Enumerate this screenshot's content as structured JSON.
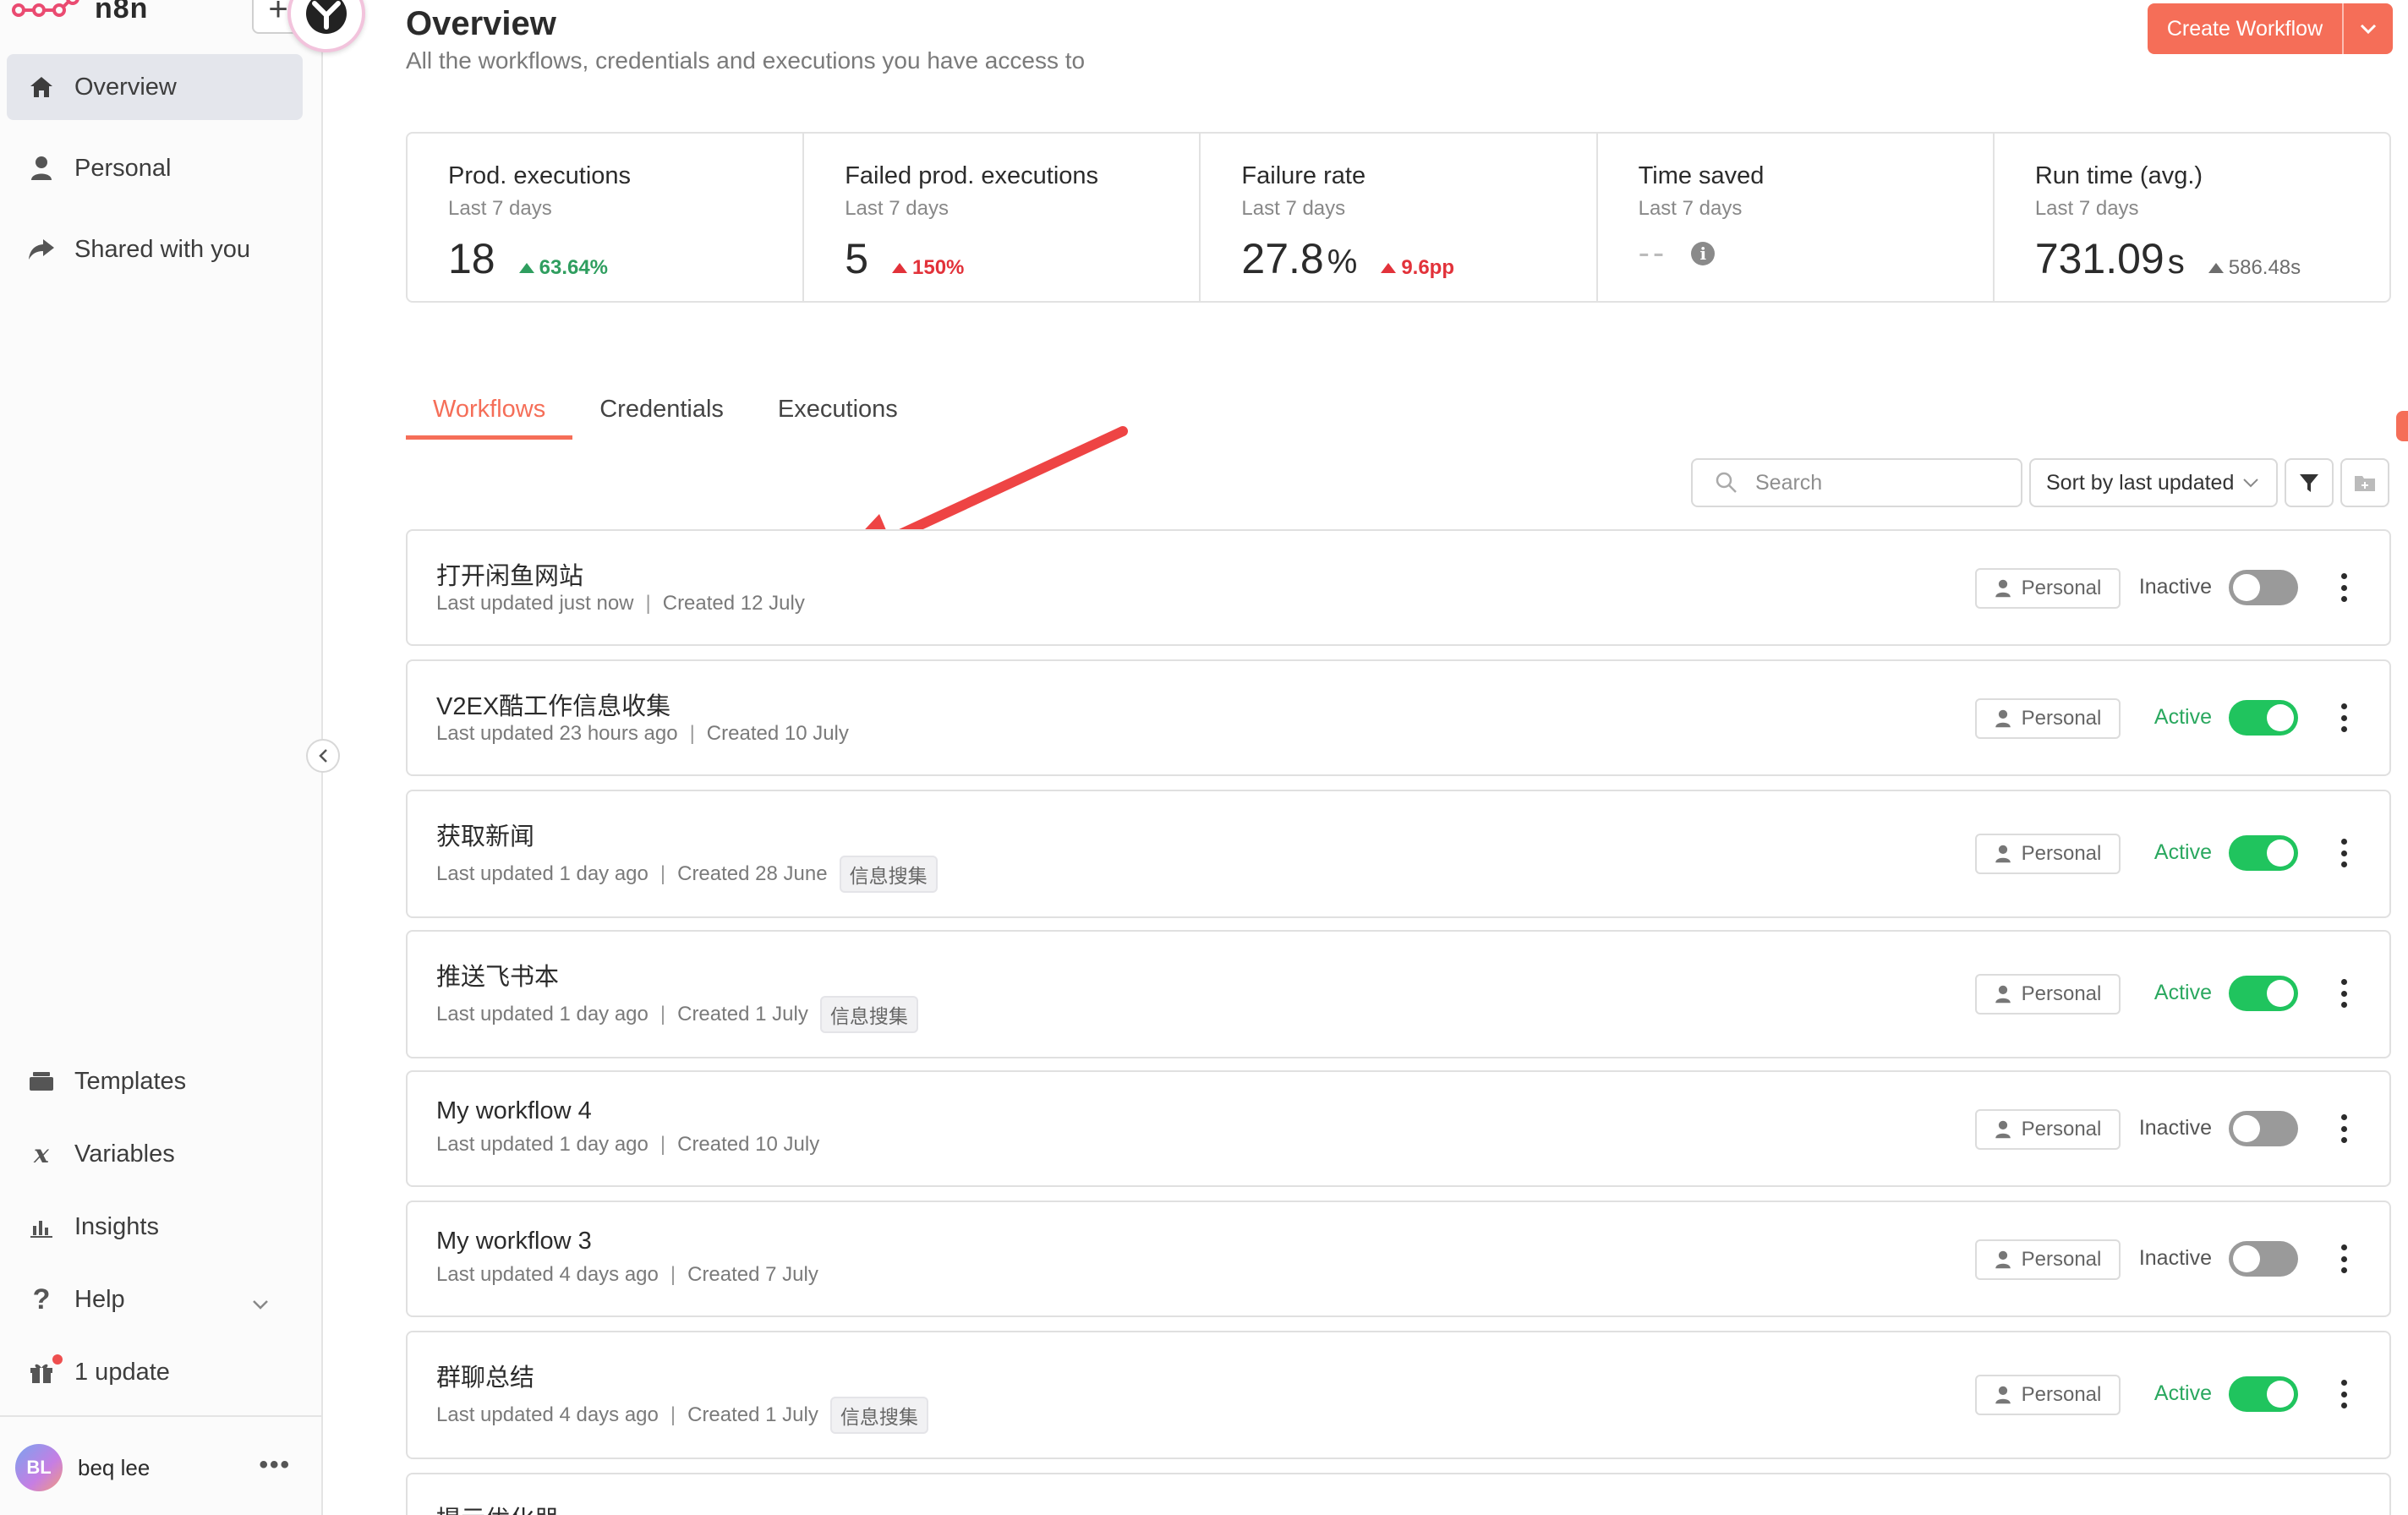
{
  "app": {
    "name": "n8n"
  },
  "sidebar": {
    "items": [
      {
        "label": "Overview",
        "icon": "home-icon"
      },
      {
        "label": "Personal",
        "icon": "user-icon"
      },
      {
        "label": "Shared with you",
        "icon": "share-icon"
      }
    ],
    "bottom_items": [
      {
        "label": "Templates",
        "icon": "templates-icon"
      },
      {
        "label": "Variables",
        "icon": "variables-icon"
      },
      {
        "label": "Insights",
        "icon": "insights-icon"
      },
      {
        "label": "Help",
        "icon": "help-icon"
      },
      {
        "label": "1 update",
        "icon": "gift-icon"
      }
    ],
    "user": {
      "initials": "BL",
      "name": "beq lee"
    }
  },
  "header": {
    "title": "Overview",
    "subtitle": "All the workflows, credentials and executions you have access to",
    "create_label": "Create Workflow"
  },
  "stats": [
    {
      "title": "Prod. executions",
      "period": "Last 7 days",
      "value": "18",
      "unit": "",
      "delta": "63.64%"
    },
    {
      "title": "Failed prod. executions",
      "period": "Last 7 days",
      "value": "5",
      "unit": "",
      "delta": "150%"
    },
    {
      "title": "Failure rate",
      "period": "Last 7 days",
      "value": "27.8",
      "unit": "%",
      "delta": "9.6pp"
    },
    {
      "title": "Time saved",
      "period": "Last 7 days",
      "value": "--",
      "unit": "",
      "delta": ""
    },
    {
      "title": "Run time (avg.)",
      "period": "Last 7 days",
      "value": "731.09",
      "unit": "s",
      "delta": "586.48s"
    }
  ],
  "tabs": [
    {
      "label": "Workflows"
    },
    {
      "label": "Credentials"
    },
    {
      "label": "Executions"
    }
  ],
  "toolbar": {
    "search_placeholder": "Search",
    "sort_label": "Sort by last updated"
  },
  "workflows": [
    {
      "name": "打开闲鱼网站",
      "updated": "Last updated just now",
      "created": "Created 12 July",
      "tag": "",
      "owner": "Personal",
      "status": "Inactive"
    },
    {
      "name": "V2EX酷工作信息收集",
      "updated": "Last updated 23 hours ago",
      "created": "Created 10 July",
      "tag": "",
      "owner": "Personal",
      "status": "Active"
    },
    {
      "name": "获取新闻",
      "updated": "Last updated 1 day ago",
      "created": "Created 28 June",
      "tag": "信息搜集",
      "owner": "Personal",
      "status": "Active"
    },
    {
      "name": "推送飞书本",
      "updated": "Last updated 1 day ago",
      "created": "Created 1 July",
      "tag": "信息搜集",
      "owner": "Personal",
      "status": "Active"
    },
    {
      "name": "My workflow 4",
      "updated": "Last updated 1 day ago",
      "created": "Created 10 July",
      "tag": "",
      "owner": "Personal",
      "status": "Inactive"
    },
    {
      "name": "My workflow 3",
      "updated": "Last updated 4 days ago",
      "created": "Created 7 July",
      "tag": "",
      "owner": "Personal",
      "status": "Inactive"
    },
    {
      "name": "群聊总结",
      "updated": "Last updated 4 days ago",
      "created": "Created 1 July",
      "tag": "信息搜集",
      "owner": "Personal",
      "status": "Active"
    },
    {
      "name": "提示优化器",
      "updated": "",
      "created": "",
      "tag": "",
      "owner": "",
      "status": ""
    }
  ],
  "colors": {
    "accent": "#f56e58",
    "active": "#20c45e",
    "inactive": "#9a9a9a",
    "annotation_arrow": "#ee4444"
  }
}
